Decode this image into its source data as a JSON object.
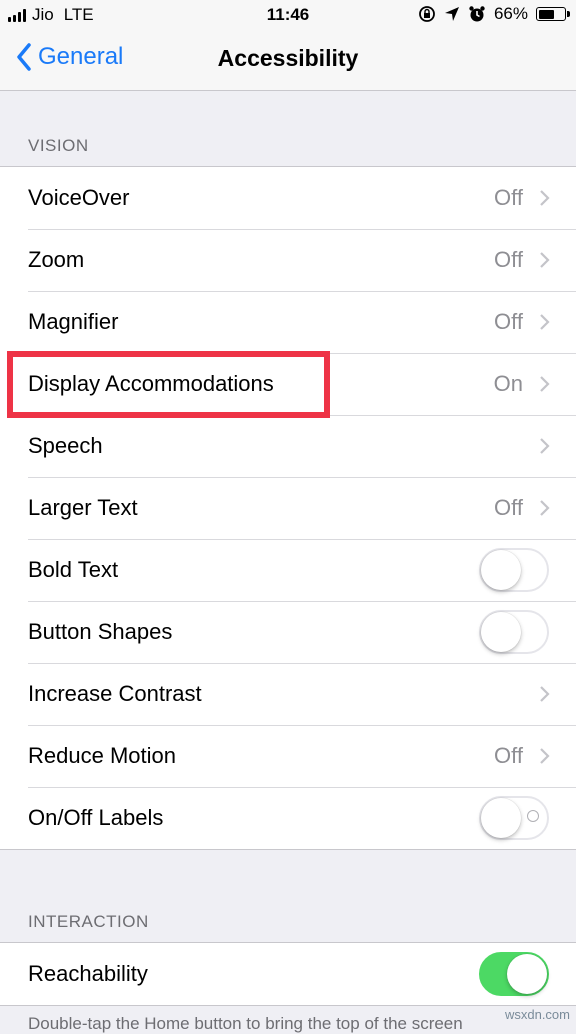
{
  "status_bar": {
    "carrier": "Jio",
    "network": "LTE",
    "time": "11:46",
    "battery": "66%",
    "battery_level": 0.66
  },
  "nav": {
    "back_label": "General",
    "title": "Accessibility"
  },
  "vision": {
    "header": "VISION",
    "rows": [
      {
        "label": "VoiceOver",
        "value": "Off"
      },
      {
        "label": "Zoom",
        "value": "Off"
      },
      {
        "label": "Magnifier",
        "value": "Off"
      },
      {
        "label": "Display Accommodations",
        "value": "On"
      },
      {
        "label": "Speech",
        "value": ""
      },
      {
        "label": "Larger Text",
        "value": "Off"
      },
      {
        "label": "Bold Text",
        "toggle": false
      },
      {
        "label": "Button Shapes",
        "toggle": false
      },
      {
        "label": "Increase Contrast",
        "value": ""
      },
      {
        "label": "Reduce Motion",
        "value": "Off"
      },
      {
        "label": "On/Off Labels",
        "toggle": false
      }
    ]
  },
  "interaction": {
    "header": "INTERACTION",
    "rows": [
      {
        "label": "Reachability",
        "toggle": true
      }
    ],
    "footer": "Double-tap the Home button to bring the top of the screen"
  },
  "watermark": "wsxdn.com",
  "colors": {
    "accent": "#1a7af8",
    "toggle_on": "#4cd964",
    "highlight": "#ee3346"
  }
}
